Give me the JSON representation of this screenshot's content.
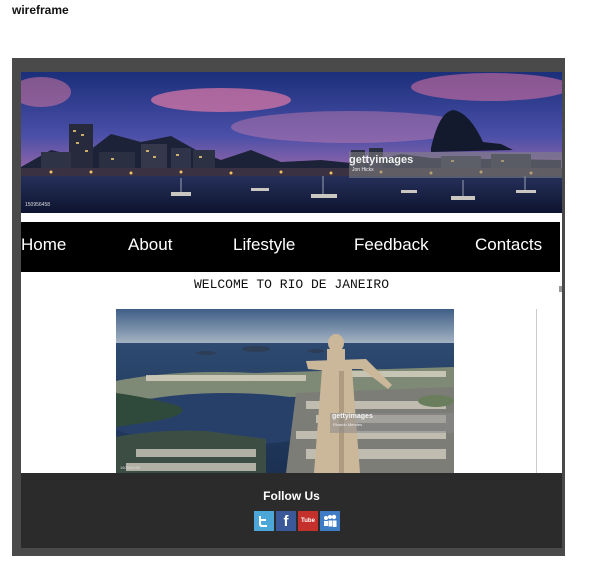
{
  "doc": {
    "title": "wireframe"
  },
  "header": {
    "watermark": "gettyimages",
    "watermark_credit": "Jon Hicks",
    "image_id": "150956458"
  },
  "nav": {
    "items": [
      {
        "label": "Home"
      },
      {
        "label": "About"
      },
      {
        "label": "Lifestyle"
      },
      {
        "label": "Feedback"
      },
      {
        "label": "Contacts"
      }
    ]
  },
  "main": {
    "heading": "WELCOME TO RIO DE JANEIRO",
    "photo": {
      "watermark": "gettyimages",
      "watermark_credit": "Ricardo Mendes",
      "image_id": "160506469"
    }
  },
  "footer": {
    "follow_label": "Follow Us",
    "social": [
      {
        "icon": "twitter-icon",
        "glyph": ""
      },
      {
        "icon": "facebook-icon",
        "glyph": "f"
      },
      {
        "icon": "youtube-icon",
        "glyph": "Tube"
      },
      {
        "icon": "myspace-icon",
        "glyph": ""
      }
    ]
  },
  "colors": {
    "frame": "#4a4a4a",
    "nav_bg": "#000000",
    "footer_bg": "#2b2b2b"
  }
}
